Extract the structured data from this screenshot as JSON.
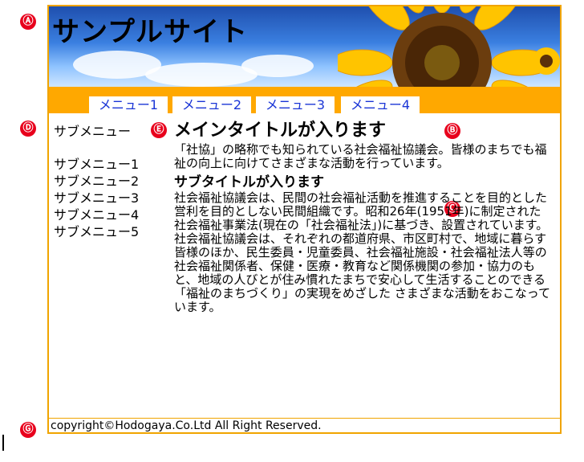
{
  "markers": {
    "a": "Ⓐ",
    "b": "Ⓑ",
    "c": "Ⓒ",
    "d": "Ⓓ",
    "e": "Ⓔ",
    "g": "Ⓖ"
  },
  "site": {
    "title": "サンプルサイト"
  },
  "nav": {
    "items": [
      "メニュー1",
      "メニュー2",
      "メニュー3",
      "メニュー4"
    ]
  },
  "sidebar": {
    "heading": "サブメニュー",
    "items": [
      "サブメニュー1",
      "サブメニュー2",
      "サブメニュー3",
      "サブメニュー4",
      "サブメニュー5"
    ]
  },
  "main": {
    "title": "メインタイトルが入ります",
    "intro": "「社協」の略称でも知られている社会福祉協議会。皆様のまちでも福祉の向上に向けてさまざまな活動を行っています。",
    "subtitle": "サブタイトルが入ります",
    "p1": "社会福祉協議会は、民間の社会福祉活動を推進することを目的とした営利を目的としない民間組織です。昭和26年(1951年)に制定された社会福祉事業法(現在の「社会福祉法」)に基づき、設置されています。",
    "p2": "社会福祉協議会は、それぞれの都道府県、市区町村で、地域に暮らす皆様のほか、民生委員・児童委員、社会福祉施設・社会福祉法人等の社会福祉関係者、保健・医療・教育など関係機関の参加・協力のもと、地域の人びとが住み慣れたまちで安心して生活することのできる「福祉のまちづくり」の実現をめざした さまざまな活動をおこなっています。"
  },
  "footer": {
    "copyright": "copyright©Hodogaya.Co.Ltd All Right Reserved."
  },
  "colors": {
    "accent": "#ffa800",
    "border": "#f0a400",
    "link": "#1a35d6",
    "marker": "#e8001c"
  }
}
